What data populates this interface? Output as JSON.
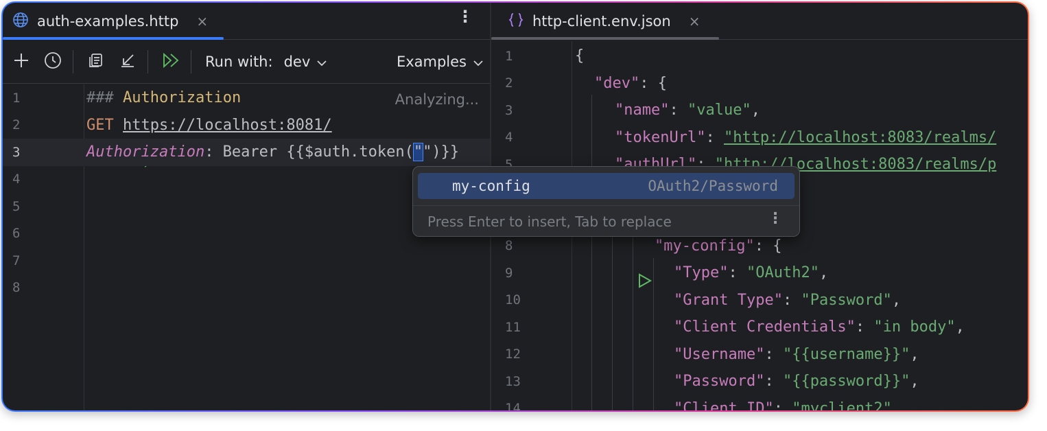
{
  "left_tab": {
    "title": "auth-examples.http",
    "close": "×",
    "menu": "⋮"
  },
  "right_tab": {
    "title": "http-client.env.json",
    "close": "×"
  },
  "toolbar": {
    "run_with_label": "Run with:",
    "env_value": "dev",
    "examples_label": "Examples"
  },
  "status": {
    "analyzing": "Analyzing..."
  },
  "left_editor": {
    "line_numbers": [
      "1",
      "2",
      "3",
      "4",
      "5",
      "6",
      "7",
      "8"
    ],
    "line1": {
      "hashes": "###",
      "title": "Authorization"
    },
    "line2": {
      "method": "GET",
      "url": "https://localhost:8081/"
    },
    "line3": {
      "header": "Authorization",
      "colon": ":",
      "pre": " Bearer {{$auth.token(",
      "quote_open": "\"",
      "caret_char": "\"",
      "post": ")}}"
    }
  },
  "right_editor": {
    "line_numbers": [
      "1",
      "2",
      "3",
      "4",
      "5",
      "8",
      "9",
      "10",
      "11",
      "12",
      "13",
      "14"
    ],
    "l1": "{",
    "l2": {
      "key": "\"dev\"",
      "rest": ": {"
    },
    "l3": {
      "key": "\"name\"",
      "sep": ": ",
      "val": "\"value\"",
      "end": ","
    },
    "l4": {
      "key": "\"tokenUrl\"",
      "sep": ": ",
      "val": "\"http://localhost:8083/realms/"
    },
    "l5": {
      "key": "\"authUrl\"",
      "sep": ": ",
      "val": "\"http://localhost:8083/realms/p"
    },
    "l8": {
      "key": "\"my-config\"",
      "rest": ": {"
    },
    "l9": {
      "key": "\"Type\"",
      "sep": ": ",
      "val": "\"OAuth2\"",
      "end": ","
    },
    "l10": {
      "key": "\"Grant Type\"",
      "sep": ": ",
      "val": "\"Password\"",
      "end": ","
    },
    "l11": {
      "key": "\"Client Credentials\"",
      "sep": ": ",
      "val": "\"in body\"",
      "end": ","
    },
    "l12": {
      "key": "\"Username\"",
      "sep": ": ",
      "val": "\"{{username}}\"",
      "end": ","
    },
    "l13": {
      "key": "\"Password\"",
      "sep": ": ",
      "val": "\"{{password}}\"",
      "end": ","
    },
    "l14": {
      "key": "\"Client ID\"",
      "sep": ": ",
      "val": "\"myclient2\"",
      "end": ","
    }
  },
  "completion_popup": {
    "item_name": "my-config",
    "item_type": "OAuth2/Password",
    "hint": "Press Enter to insert, Tab to replace",
    "menu": "⋮"
  },
  "icons": {
    "globe": "globe-icon",
    "braces": "braces-icon",
    "add": "plus-icon",
    "history": "clock-icon",
    "copy": "document-icon",
    "import": "arrow-down-left-icon",
    "run_all": "double-play-icon",
    "run": "play-icon"
  },
  "colors": {
    "accent": "#3b7bff",
    "run_green": "#5fb865",
    "selection": "#2e436e"
  }
}
